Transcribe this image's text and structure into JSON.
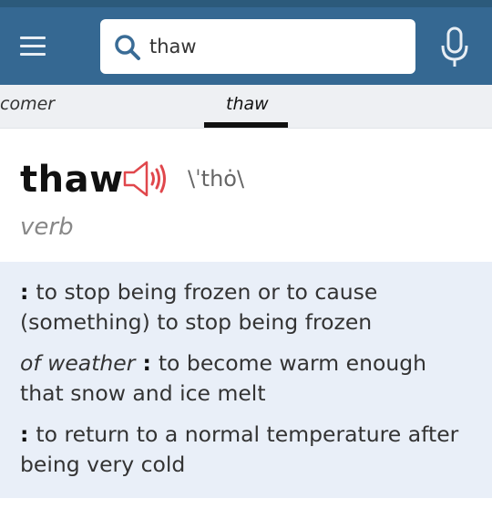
{
  "search": {
    "value": "thaw"
  },
  "icons": {
    "menu": "hamburger-menu-icon",
    "search": "magnifier-icon",
    "mic": "microphone-icon",
    "speaker": "speaker-icon"
  },
  "tabs": [
    {
      "label": "comer",
      "active": false
    },
    {
      "label": "thaw",
      "active": true
    }
  ],
  "entry": {
    "headword": "thaw",
    "pronunciation": "\\ˈthȯ\\",
    "part_of_speech": "verb",
    "definitions": [
      {
        "label": "",
        "text": "to stop being frozen or to cause (something) to stop being frozen"
      },
      {
        "label": "of weather",
        "text": "to become warm enough that snow and ice melt"
      },
      {
        "label": "",
        "text": "to return to a normal temperature after being very cold"
      }
    ]
  },
  "colors": {
    "appbar": "#356892",
    "statusbar": "#2c5a7b",
    "tabs_bg": "#eef0f3",
    "definitions_bg": "#e9eff8",
    "speaker_icon": "#e0474c"
  }
}
